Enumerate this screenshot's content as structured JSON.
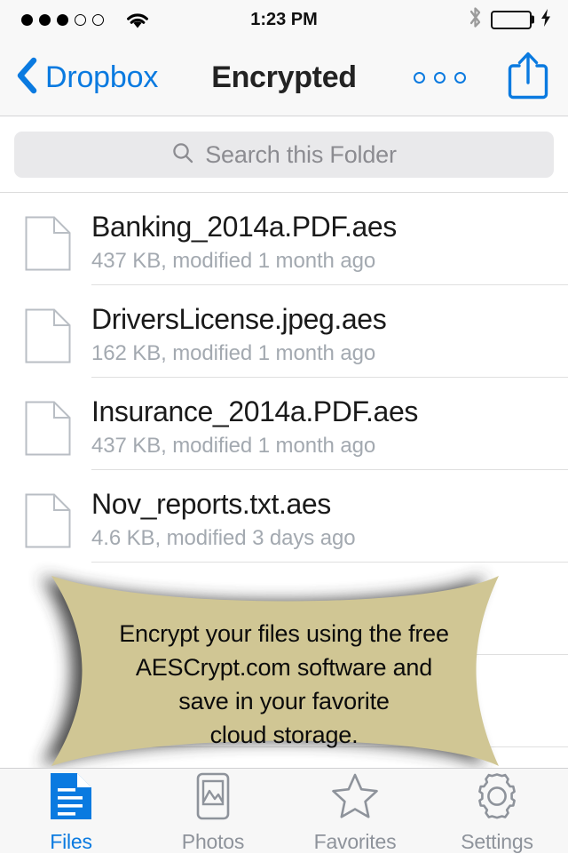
{
  "status_bar": {
    "signal_dots_filled": 3,
    "signal_dots_empty": 2,
    "wifi_icon": "wifi-icon",
    "time": "1:23 PM",
    "bluetooth_icon": "bluetooth-icon",
    "battery_icon": "battery-icon",
    "battery_charging_icon": "lightning-bolt-icon",
    "battery_color": "#4CD964"
  },
  "nav_bar": {
    "back_icon": "chevron-left-icon",
    "back_label": "Dropbox",
    "title": "Encrypted",
    "more_icon": "three-dots-icon",
    "share_icon": "share-icon",
    "accent_color": "#0a7ae0"
  },
  "search": {
    "icon": "search-icon",
    "placeholder": "Search this Folder",
    "value": ""
  },
  "files": [
    {
      "icon": "document-icon",
      "name": "Banking_2014a.PDF.aes",
      "meta": "437 KB, modified 1 month ago"
    },
    {
      "icon": "document-icon",
      "name": "DriversLicense.jpeg.aes",
      "meta": "162 KB, modified 1 month ago"
    },
    {
      "icon": "document-icon",
      "name": "Insurance_2014a.PDF.aes",
      "meta": "437 KB, modified 1 month ago"
    },
    {
      "icon": "document-icon",
      "name": "Nov_reports.txt.aes",
      "meta": "4.6 KB, modified 3 days ago"
    }
  ],
  "banner": {
    "fill_color": "#d0c694",
    "shadow_color": "#3a3a3a",
    "lines": [
      "Encrypt your files using the free",
      "AESCrypt.com software and",
      "save in your favorite",
      "cloud storage."
    ]
  },
  "tab_bar": {
    "tabs": [
      {
        "icon": "files-document-icon",
        "label": "Files",
        "active": true
      },
      {
        "icon": "photos-image-icon",
        "label": "Photos",
        "active": false
      },
      {
        "icon": "star-icon",
        "label": "Favorites",
        "active": false
      },
      {
        "icon": "gear-icon",
        "label": "Settings",
        "active": false
      }
    ],
    "active_color": "#0a7ae0",
    "inactive_color": "#8e939b"
  }
}
